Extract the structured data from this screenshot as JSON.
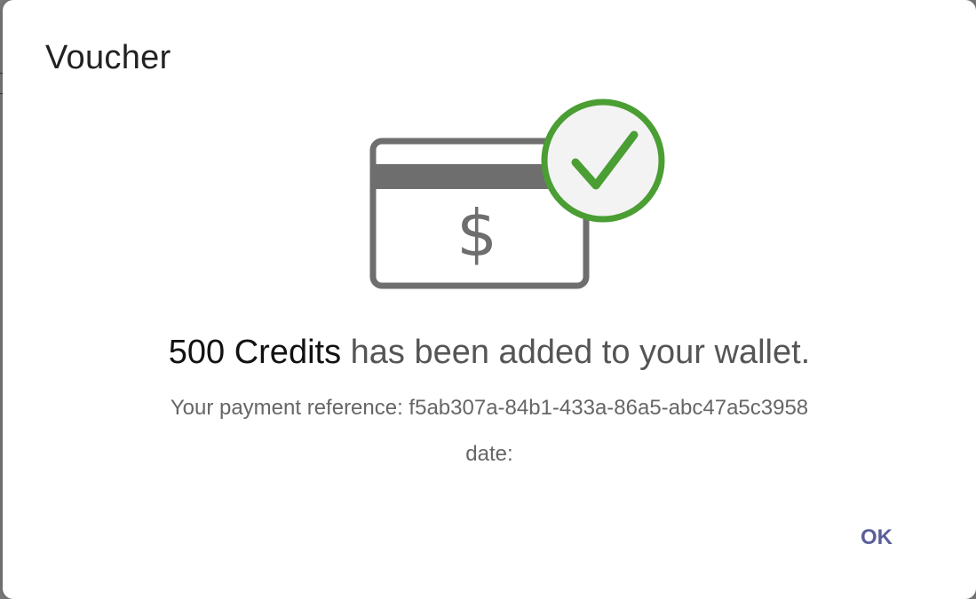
{
  "dialog": {
    "title": "Voucher",
    "credits_amount": "500 Credits",
    "message_suffix": "has been added to your wallet.",
    "reference_text": "Your payment reference: f5ab307a-84b1-433a-86a5-abc47a5c3958",
    "date_text": "date:",
    "ok_label": "OK"
  },
  "illustration": {
    "card_icon": "credit-card-dollar-icon",
    "check_icon": "check-circle-icon",
    "dollar_symbol": "$"
  },
  "colors": {
    "accent": "#5a5f9a",
    "success_green": "#4a9e33",
    "card_gray": "#6e6e6e"
  }
}
